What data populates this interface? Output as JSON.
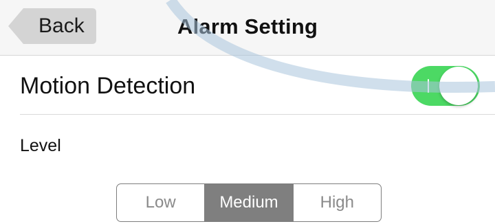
{
  "nav": {
    "back_label": "Back",
    "title": "Alarm Setting"
  },
  "motion_detection": {
    "label": "Motion Detection",
    "enabled": true,
    "toggle_color": "#4cd964"
  },
  "level": {
    "label": "Level",
    "options": [
      "Low",
      "Medium",
      "High"
    ],
    "selected": "Medium"
  },
  "colors": {
    "nav_background": "#f6f6f6",
    "segment_selected": "#7f7f7f",
    "segment_border": "#7d7d7d"
  }
}
